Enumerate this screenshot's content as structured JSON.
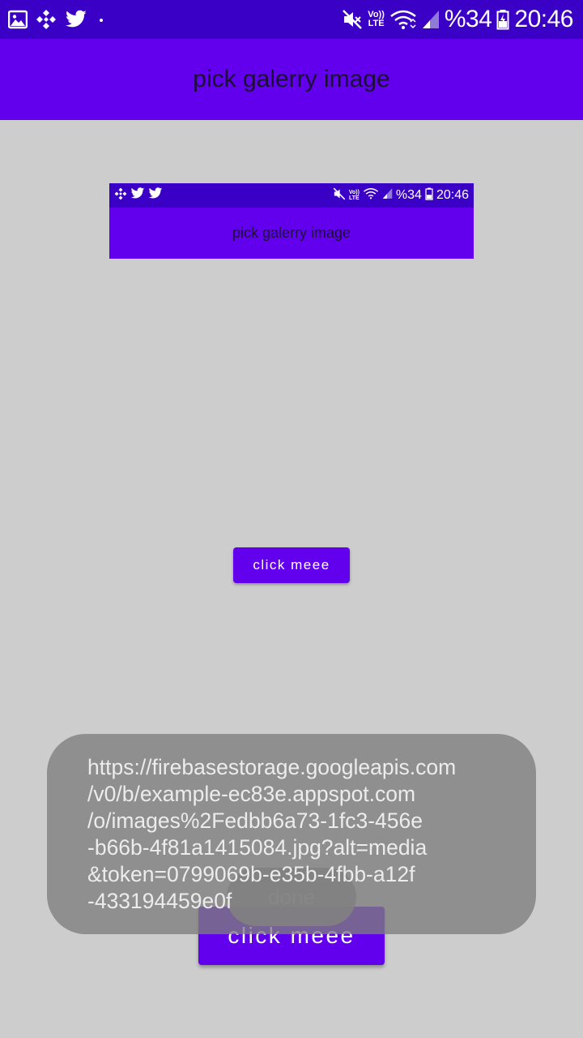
{
  "status_bar": {
    "left_icons": [
      "gallery-icon",
      "binance-icon",
      "twitter-icon",
      "dot-icon"
    ],
    "right_icons": [
      "mute-icon",
      "volte-icon",
      "wifi-icon",
      "signal-icon",
      "battery-icon"
    ],
    "volte_top": "Vo))",
    "volte_bottom": "LTE",
    "battery_percent": "%34",
    "time": "20:46"
  },
  "app_bar": {
    "title": "pick galerry image"
  },
  "preview_image": {
    "status_bar": {
      "left_icons": [
        "binance-icon",
        "twitter-icon",
        "twitter-icon"
      ],
      "volte_top": "Vo))",
      "volte_bottom": "LTE",
      "battery_percent": "%34",
      "time": "20:46"
    },
    "title": "pick galerry image"
  },
  "buttons": {
    "small_label": "click meee",
    "large_label": "click meee"
  },
  "toasts": {
    "done_text": "done",
    "url_text": "https://firebasestorage.googleapis.com\n/v0/b/example-ec83e.appspot.com\n/o/images%2Fedbb6a73-1fc3-456e\n-b66b-4f81a1415084.jpg?alt=media\n&token=0799069b-e35b-4fbb-a12f\n-433194459e0f"
  },
  "colors": {
    "status_bar": "#3a00c6",
    "primary": "#6200ee",
    "background": "#cdcdcd",
    "toast": "#7d7d7d"
  }
}
